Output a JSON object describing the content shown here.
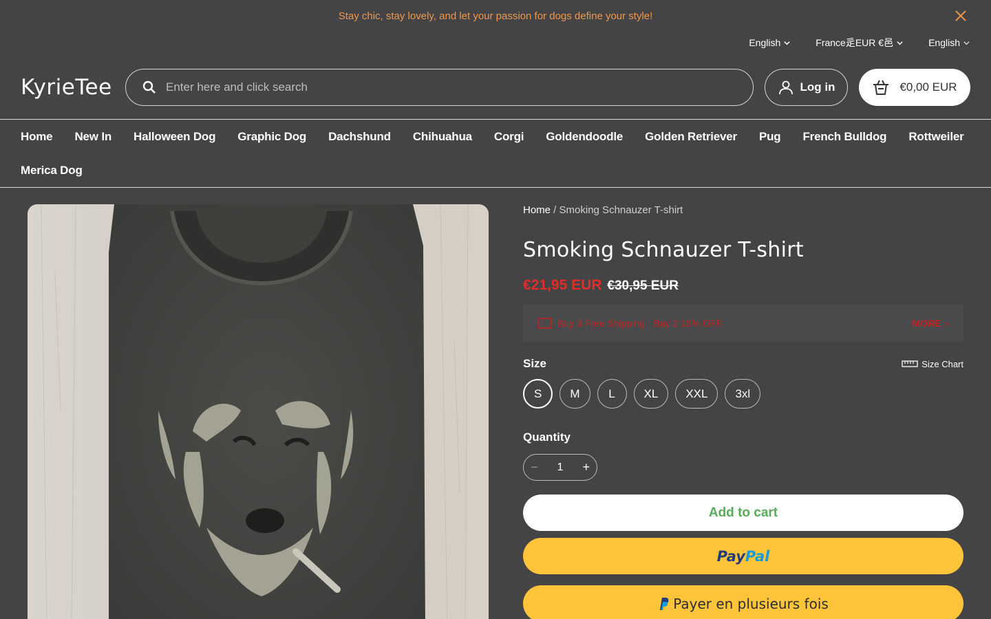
{
  "announcement": {
    "text": "Stay chic, stay lovely, and let your passion for dogs define your style!",
    "color": "#f0984a"
  },
  "locale": {
    "language1": "English",
    "country": "France⾡EUR €⾢",
    "language2": "English"
  },
  "header": {
    "logo": "KyrieTee",
    "search_placeholder": "Enter here and click search",
    "login_label": "Log in",
    "cart_total": "€0,00 EUR"
  },
  "nav": {
    "items": [
      "Home",
      "New In",
      "Halloween Dog",
      "Graphic Dog",
      "Dachshund",
      "Chihuahua",
      "Corgi",
      "Goldendoodle",
      "Golden Retriever",
      "Pug",
      "French Bulldog",
      "Rottweiler",
      "Merica Dog"
    ]
  },
  "product": {
    "breadcrumb_home": "Home",
    "breadcrumb_sep": " / ",
    "breadcrumb_current": "Smoking Schnauzer T-shirt",
    "title": "Smoking Schnauzer T-shirt",
    "price_sale": "€21,95 EUR",
    "price_compare": "€30,95 EUR",
    "sale_color": "#e42c27",
    "promo_text": "Buy 3 Free Shipping · Buy 2 10% OFF",
    "promo_more": "MORE",
    "size_label": "Size",
    "size_chart_label": "Size Chart",
    "sizes": [
      "S",
      "M",
      "L",
      "XL",
      "XXL",
      "3xl"
    ],
    "selected_size": "S",
    "quantity_label": "Quantity",
    "quantity_value": "1",
    "add_to_cart": "Add to cart",
    "paypal_pay": "Pay",
    "paypal_pal": "Pal",
    "paylater_label": "Payer en plusieurs fois"
  }
}
